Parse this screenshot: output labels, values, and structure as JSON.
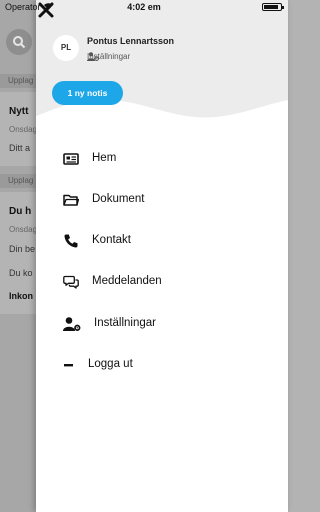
{
  "status_bar": {
    "carrier": "Operator",
    "time": "4:02 em",
    "battery_level": 0.9
  },
  "background": {
    "sections": [
      "Upplag",
      "Upplag"
    ],
    "cards": [
      {
        "title": "Nytt",
        "date": "Onsdag",
        "text": "Ditt a"
      },
      {
        "title": "Du h",
        "date": "Onsdag",
        "lines": [
          "Din be",
          "Du ko",
          "Inkon"
        ]
      }
    ]
  },
  "drawer": {
    "user": {
      "initials": "PL",
      "name": "Pontus Lennartsson",
      "settings_label": "Inställningar"
    },
    "notice_label": "1 ny notis",
    "menu": [
      {
        "label": "Hem",
        "icon": "news-icon"
      },
      {
        "label": "Dokument",
        "icon": "folder-icon"
      },
      {
        "label": "Kontakt",
        "icon": "phone-icon"
      },
      {
        "label": "Meddelanden",
        "icon": "chat-bubbles-icon"
      },
      {
        "label": "Inställningar",
        "icon": "user-gear-icon"
      },
      {
        "label": "Logga ut",
        "icon": "minus-icon"
      }
    ],
    "colors": {
      "header_bg": "#ececec",
      "accent": "#1ea7e8"
    }
  }
}
